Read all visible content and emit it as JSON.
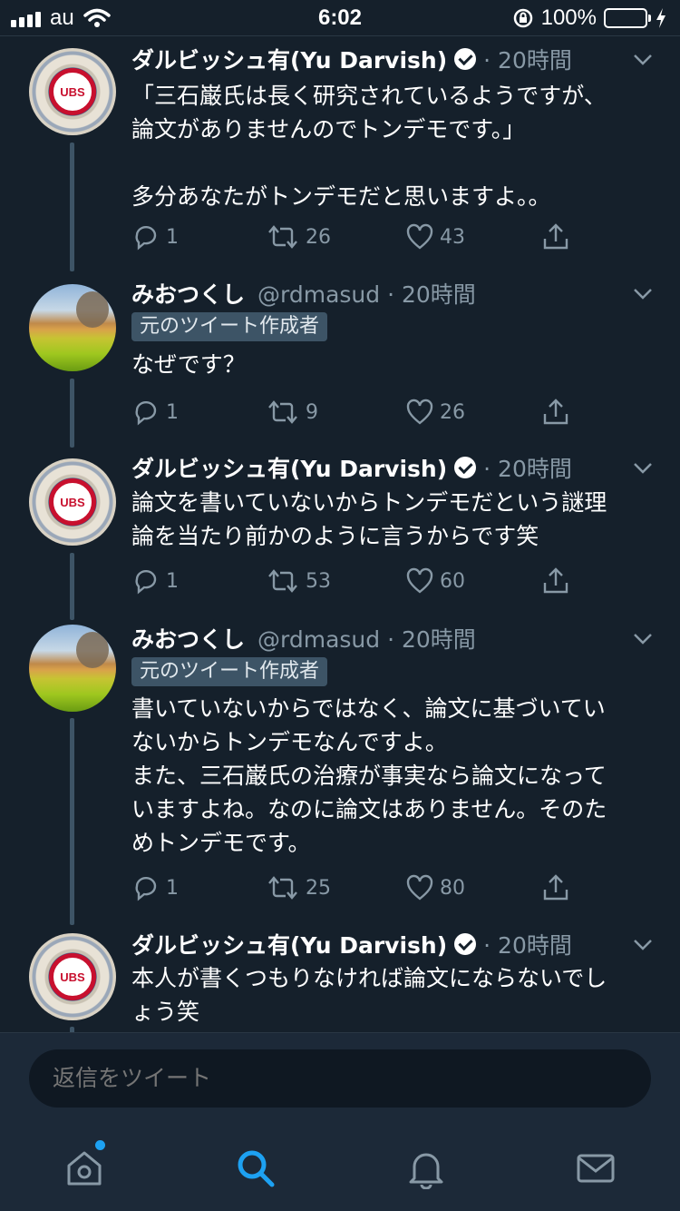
{
  "status_bar": {
    "carrier": "au",
    "time": "6:02",
    "battery": "100%"
  },
  "tweets": [
    {
      "name": "ダルビッシュ有(Yu Darvish)",
      "verified": true,
      "meta": "· 20時間",
      "badge": "",
      "avatar": "cubs-logo-avatar",
      "text": "「三石巌氏は長く研究されているようですが、\n論文がありませんのでトンデモです。」\n\n多分あなたがトンデモだと思いますよ。。",
      "replies": "1",
      "retweets": "26",
      "likes": "43"
    },
    {
      "name": "みおつくし",
      "verified": false,
      "meta": "@rdmasud · 20時間",
      "badge": "元のツイート作成者",
      "avatar": "field-landscape-avatar",
      "text": "なぜです？",
      "replies": "1",
      "retweets": "9",
      "likes": "26"
    },
    {
      "name": "ダルビッシュ有(Yu Darvish)",
      "verified": true,
      "meta": "· 20時間",
      "badge": "",
      "avatar": "cubs-logo-avatar",
      "text": "論文を書いていないからトンデモだという謎理\n論を当たり前かのように言うからです笑",
      "replies": "1",
      "retweets": "53",
      "likes": "60"
    },
    {
      "name": "みおつくし",
      "verified": false,
      "meta": "@rdmasud · 20時間",
      "badge": "元のツイート作成者",
      "avatar": "field-landscape-avatar",
      "text": "書いていないからではなく、論文に基づいてい\nないからトンデモなんですよ。\nまた、三石巌氏の治療が事実なら論文になって\nいますよね。なのに論文はありません。そのた\nめトンデモです。",
      "replies": "1",
      "retweets": "25",
      "likes": "80"
    },
    {
      "name": "ダルビッシュ有(Yu Darvish)",
      "verified": true,
      "meta": "· 20時間",
      "badge": "",
      "avatar": "cubs-logo-avatar",
      "text": "本人が書くつもりなければ論文にならないでし\nょう笑"
    }
  ],
  "reply_bar": {
    "placeholder": "返信をツイート"
  },
  "avatar_logo_text": "UBS",
  "tab_bar": {
    "items": [
      "home-icon",
      "search-icon",
      "notifications-bell-icon",
      "messages-envelope-icon"
    ],
    "active": "search-icon",
    "home_has_new_dot": true
  },
  "colors": {
    "background": "#15202b",
    "accent": "#1da1f2",
    "secondary_text": "#8899a6",
    "battery": "#4cd964"
  }
}
